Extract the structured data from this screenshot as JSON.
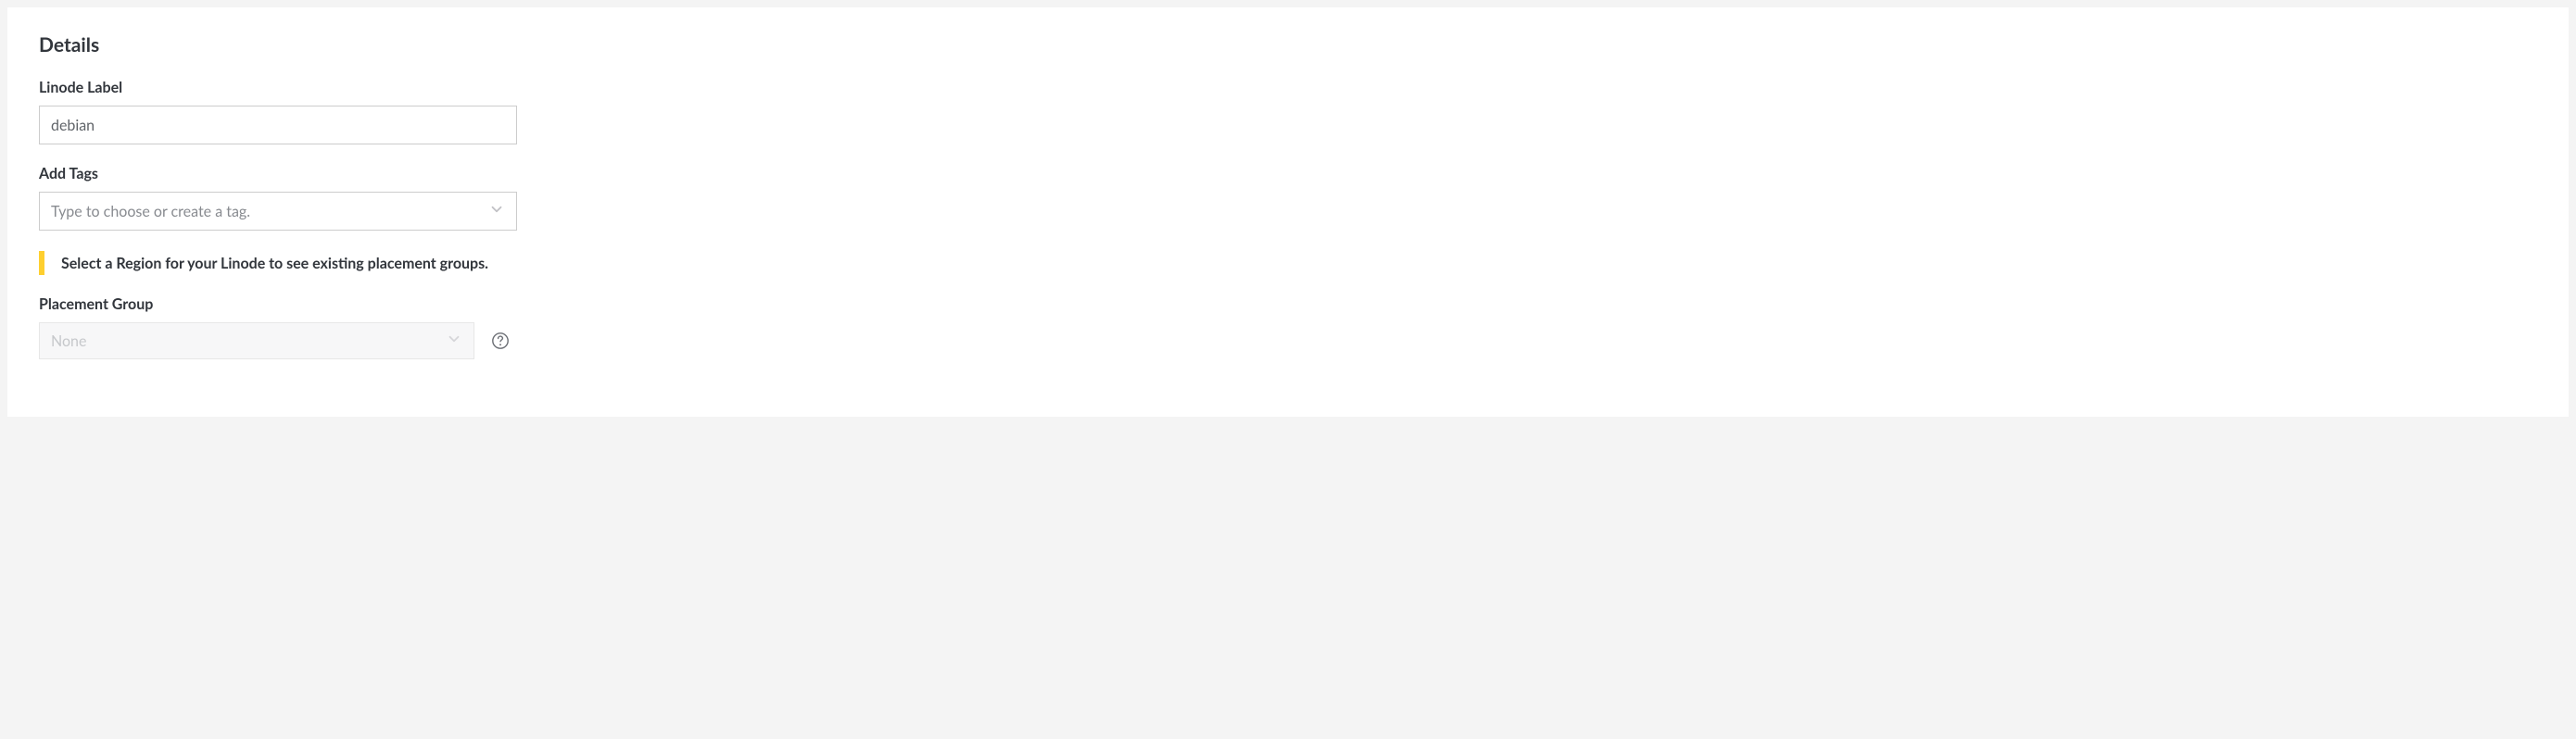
{
  "details": {
    "title": "Details",
    "linode_label": {
      "label": "Linode Label",
      "value": "debian"
    },
    "add_tags": {
      "label": "Add Tags",
      "placeholder": "Type to choose or create a tag."
    },
    "notice": {
      "text": "Select a Region for your Linode to see existing placement groups."
    },
    "placement_group": {
      "label": "Placement Group",
      "value": "None"
    }
  }
}
